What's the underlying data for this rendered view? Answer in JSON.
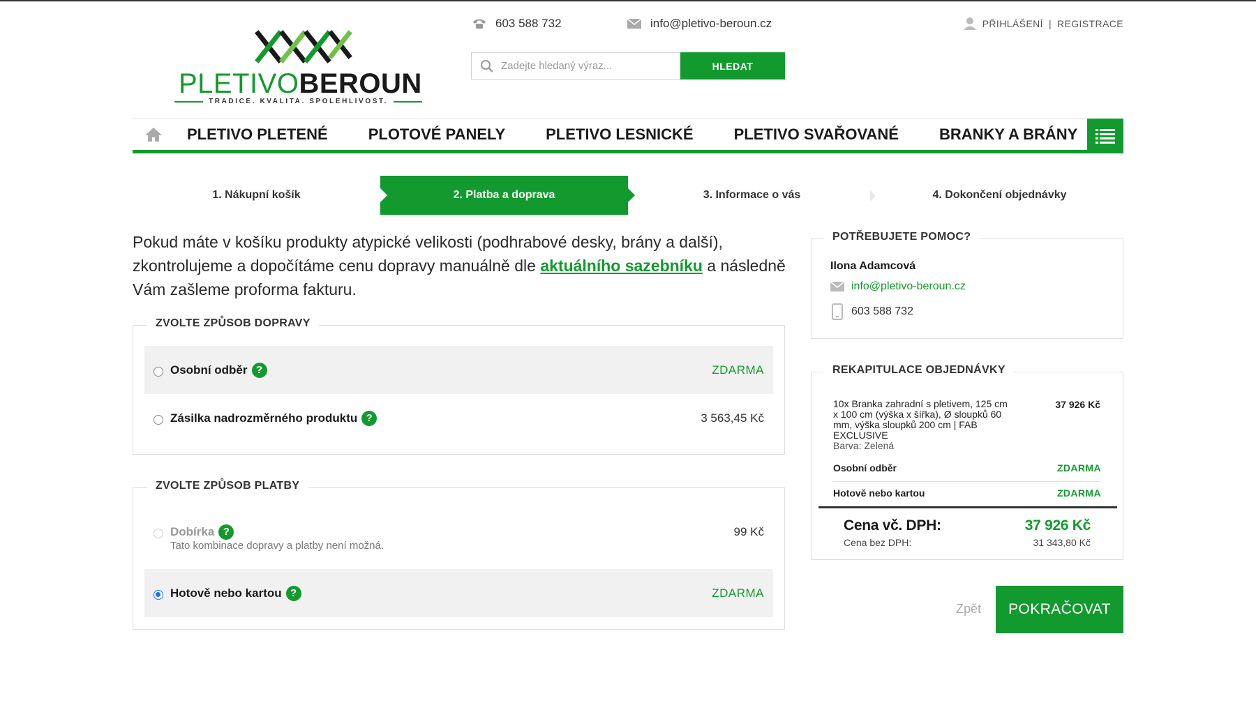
{
  "header": {
    "logo": {
      "word_light": "PLETIVO",
      "word_bold": "BEROUN",
      "tagline": "TRADICE. KVALITA. SPOLEHLIVOST."
    },
    "phone": "603 588 732",
    "email": "info@pletivo-beroun.cz",
    "search": {
      "placeholder": "Zadejte hledaný výraz...",
      "button": "HLEDAT"
    },
    "account": {
      "login": "PŘIHLÁŠENÍ",
      "separator": "|",
      "register": "REGISTRACE"
    }
  },
  "nav": {
    "items": [
      "PLETIVO PLETENÉ",
      "PLOTOVÉ PANELY",
      "PLETIVO LESNICKÉ",
      "PLETIVO SVAŘOVANÉ",
      "BRANKY A BRÁNY"
    ]
  },
  "steps": [
    {
      "label": "1. Nákupní košík",
      "active": false
    },
    {
      "label": "2. Platba a doprava",
      "active": true
    },
    {
      "label": "3. Informace o vás",
      "active": false
    },
    {
      "label": "4. Dokončení objednávky",
      "active": false
    }
  ],
  "intro": {
    "before": "Pokud máte v košíku produkty atypické velikosti (podhrabové desky, brány a další), zkontrolujeme a dopočítáme cenu dopravy manuálně dle ",
    "link": "aktuálního sazebníku",
    "after": " a následně Vám zašleme proforma fakturu."
  },
  "shipping": {
    "legend": "ZVOLTE ZPŮSOB DOPRAVY",
    "options": [
      {
        "label": "Osobní odběr",
        "price": "ZDARMA",
        "selected": false
      },
      {
        "label": "Zásilka nadrozměrného produktu",
        "price": "3 563,45 Kč",
        "selected": false
      }
    ]
  },
  "payment": {
    "legend": "ZVOLTE ZPŮSOB PLATBY",
    "options": [
      {
        "label": "Dobírka",
        "price": "99 Kč",
        "note": "Tato kombinace dopravy a platby není možná.",
        "disabled": true
      },
      {
        "label": "Hotově nebo kartou",
        "price": "ZDARMA",
        "selected": true
      }
    ]
  },
  "help": {
    "legend": "POTŘEBUJETE POMOC?",
    "name": "Ilona Adamcová",
    "email": "info@pletivo-beroun.cz",
    "phone": "603 588 732"
  },
  "recap": {
    "legend": "REKAPITULACE OBJEDNÁVKY",
    "item": {
      "name": "10x Branka zahradní s pletivem, 125 cm x 100 cm (výška x šířka), Ø sloupků 60 mm, výška sloupků 200 cm | FAB EXCLUSIVE",
      "variant": "Barva: Zelená",
      "price": "37 926 Kč"
    },
    "shipping": {
      "label": "Osobní odběr",
      "price": "ZDARMA"
    },
    "payment": {
      "label": "Hotově nebo kartou",
      "price": "ZDARMA"
    },
    "total_label": "Cena vč. DPH:",
    "total": "37 926 Kč",
    "net_label": "Cena bez DPH:",
    "net": "31 343,80 Kč"
  },
  "actions": {
    "back": "Zpět",
    "continue": "POKRAČOVAT"
  },
  "colors": {
    "brand_green": "#139a2e",
    "dark": "#1a1a1a",
    "radio_selected": "#1a73e8"
  }
}
